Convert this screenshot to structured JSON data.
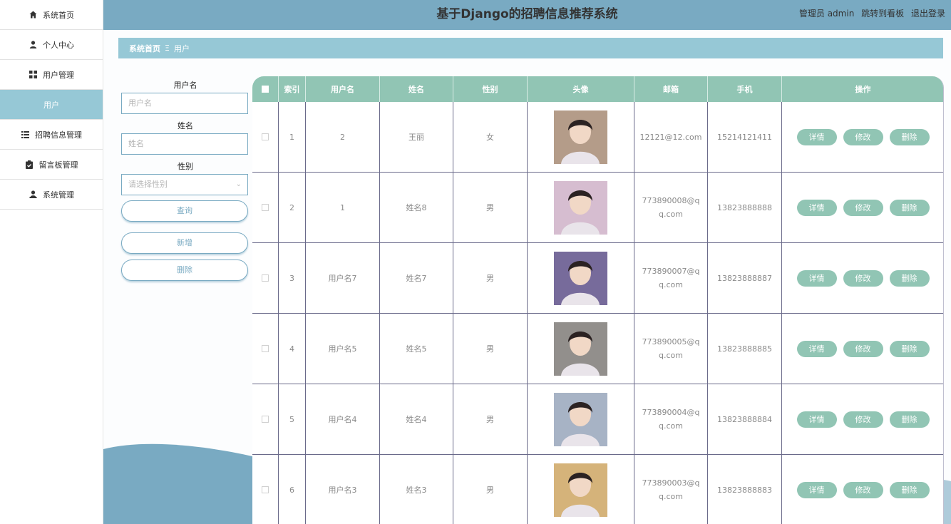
{
  "sidebar": {
    "items": [
      {
        "label": "系统首页",
        "icon": "home-icon"
      },
      {
        "label": "个人中心",
        "icon": "person-icon"
      },
      {
        "label": "用户管理",
        "icon": "grid-icon"
      },
      {
        "label": "用户",
        "icon": ""
      },
      {
        "label": "招聘信息管理",
        "icon": "list-icon"
      },
      {
        "label": "留言板管理",
        "icon": "clipboard-icon"
      },
      {
        "label": "系统管理",
        "icon": "person-icon"
      }
    ]
  },
  "header": {
    "title": "基于Django的招聘信息推荐系统",
    "user": "管理员 admin",
    "dashboard_link": "跳转到看板",
    "logout": "退出登录"
  },
  "breadcrumb": {
    "home": "系统首页",
    "sep": "Ξ",
    "current": "用户"
  },
  "search": {
    "username_label": "用户名",
    "username_placeholder": "用户名",
    "name_label": "姓名",
    "name_placeholder": "姓名",
    "gender_label": "性别",
    "gender_placeholder": "请选择性别",
    "query_button": "查询",
    "add_button": "新增",
    "delete_button": "删除"
  },
  "table": {
    "columns": [
      "索引",
      "用户名",
      "姓名",
      "性别",
      "头像",
      "邮箱",
      "手机",
      "操作"
    ],
    "actions": {
      "detail": "详情",
      "edit": "修改",
      "delete": "删除"
    },
    "rows": [
      {
        "index": "1",
        "username": "2",
        "name": "王丽",
        "gender": "女",
        "email": "12121@12.com",
        "phone": "15214121411",
        "avatar_color": "#9b7b62"
      },
      {
        "index": "2",
        "username": "1",
        "name": "姓名8",
        "gender": "男",
        "email": "773890008@qq.com",
        "phone": "13823888888",
        "avatar_color": "#c9a7c1"
      },
      {
        "index": "3",
        "username": "用户名7",
        "name": "姓名7",
        "gender": "男",
        "email": "773890007@qq.com",
        "phone": "13823888887",
        "avatar_color": "#4a3a7a"
      },
      {
        "index": "4",
        "username": "用户名5",
        "name": "姓名5",
        "gender": "男",
        "email": "773890005@qq.com",
        "phone": "13823888885",
        "avatar_color": "#6e6a66"
      },
      {
        "index": "5",
        "username": "用户名4",
        "name": "姓名4",
        "gender": "男",
        "email": "773890004@qq.com",
        "phone": "13823888884",
        "avatar_color": "#8a9ab2"
      },
      {
        "index": "6",
        "username": "用户名3",
        "name": "姓名3",
        "gender": "男",
        "email": "773890003@qq.com",
        "phone": "13823888883",
        "avatar_color": "#c79a4e"
      }
    ]
  },
  "colors": {
    "header": "#79aac2",
    "accent": "#96c8d6",
    "table_header": "#91c5b4"
  }
}
